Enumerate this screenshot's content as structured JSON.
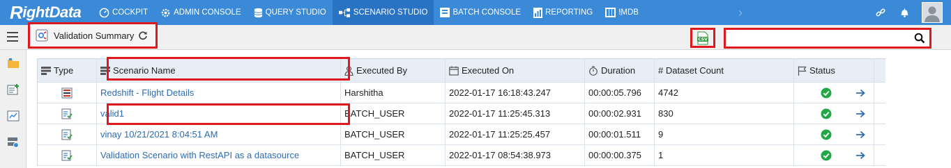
{
  "brand": {
    "name_prefix": "R",
    "name_rest": "ightData"
  },
  "nav": {
    "items": [
      {
        "label": "COCKPIT",
        "icon": "gauge-icon",
        "active": false
      },
      {
        "label": "ADMIN CONSOLE",
        "icon": "gear-icon",
        "active": false
      },
      {
        "label": "QUERY STUDIO",
        "icon": "database-icon",
        "active": false
      },
      {
        "label": "SCENARIO STUDIO",
        "icon": "workflow-icon",
        "active": true
      },
      {
        "label": "BATCH CONSOLE",
        "icon": "batch-icon",
        "active": false
      },
      {
        "label": "REPORTING",
        "icon": "report-icon",
        "active": false
      },
      {
        "label": "IMDB",
        "icon": "imdb-icon",
        "active": false
      }
    ]
  },
  "toolbar": {
    "title": "Validation Summary",
    "search_value": "",
    "search_placeholder": ""
  },
  "table": {
    "columns": [
      "Type",
      "Scenario Name",
      "Executed By",
      "Executed On",
      "Duration",
      "# Dataset Count",
      "Status"
    ],
    "rows": [
      {
        "type_icon": "scenario-report-icon",
        "name": "Redshift - Flight Details",
        "executed_by": "Harshitha",
        "executed_on": "2022-01-17 16:18:43.247",
        "duration": "00:00:05.796",
        "dataset_count": "4742",
        "status": "success"
      },
      {
        "type_icon": "validation-icon",
        "name": "valid1",
        "executed_by": "BATCH_USER",
        "executed_on": "2022-01-17 11:25:45.313",
        "duration": "00:00:02.931",
        "dataset_count": "830",
        "status": "success"
      },
      {
        "type_icon": "validation-icon",
        "name": "vinay 10/21/2021 8:04:51 AM",
        "executed_by": "BATCH_USER",
        "executed_on": "2022-01-17 11:25:25.457",
        "duration": "00:00:01.511",
        "dataset_count": "9",
        "status": "success"
      },
      {
        "type_icon": "validation-icon",
        "name": "Validation Scenario with RestAPI as a datasource",
        "executed_by": "BATCH_USER",
        "executed_on": "2022-01-17 08:54:38.973",
        "duration": "00:00:00.375",
        "dataset_count": "1",
        "status": "success"
      }
    ]
  },
  "colors": {
    "topbar": "#3b8ad8",
    "active_tab": "#2a73c2",
    "highlight": "#e0171d",
    "link": "#2d6cb5",
    "success": "#22a745"
  }
}
